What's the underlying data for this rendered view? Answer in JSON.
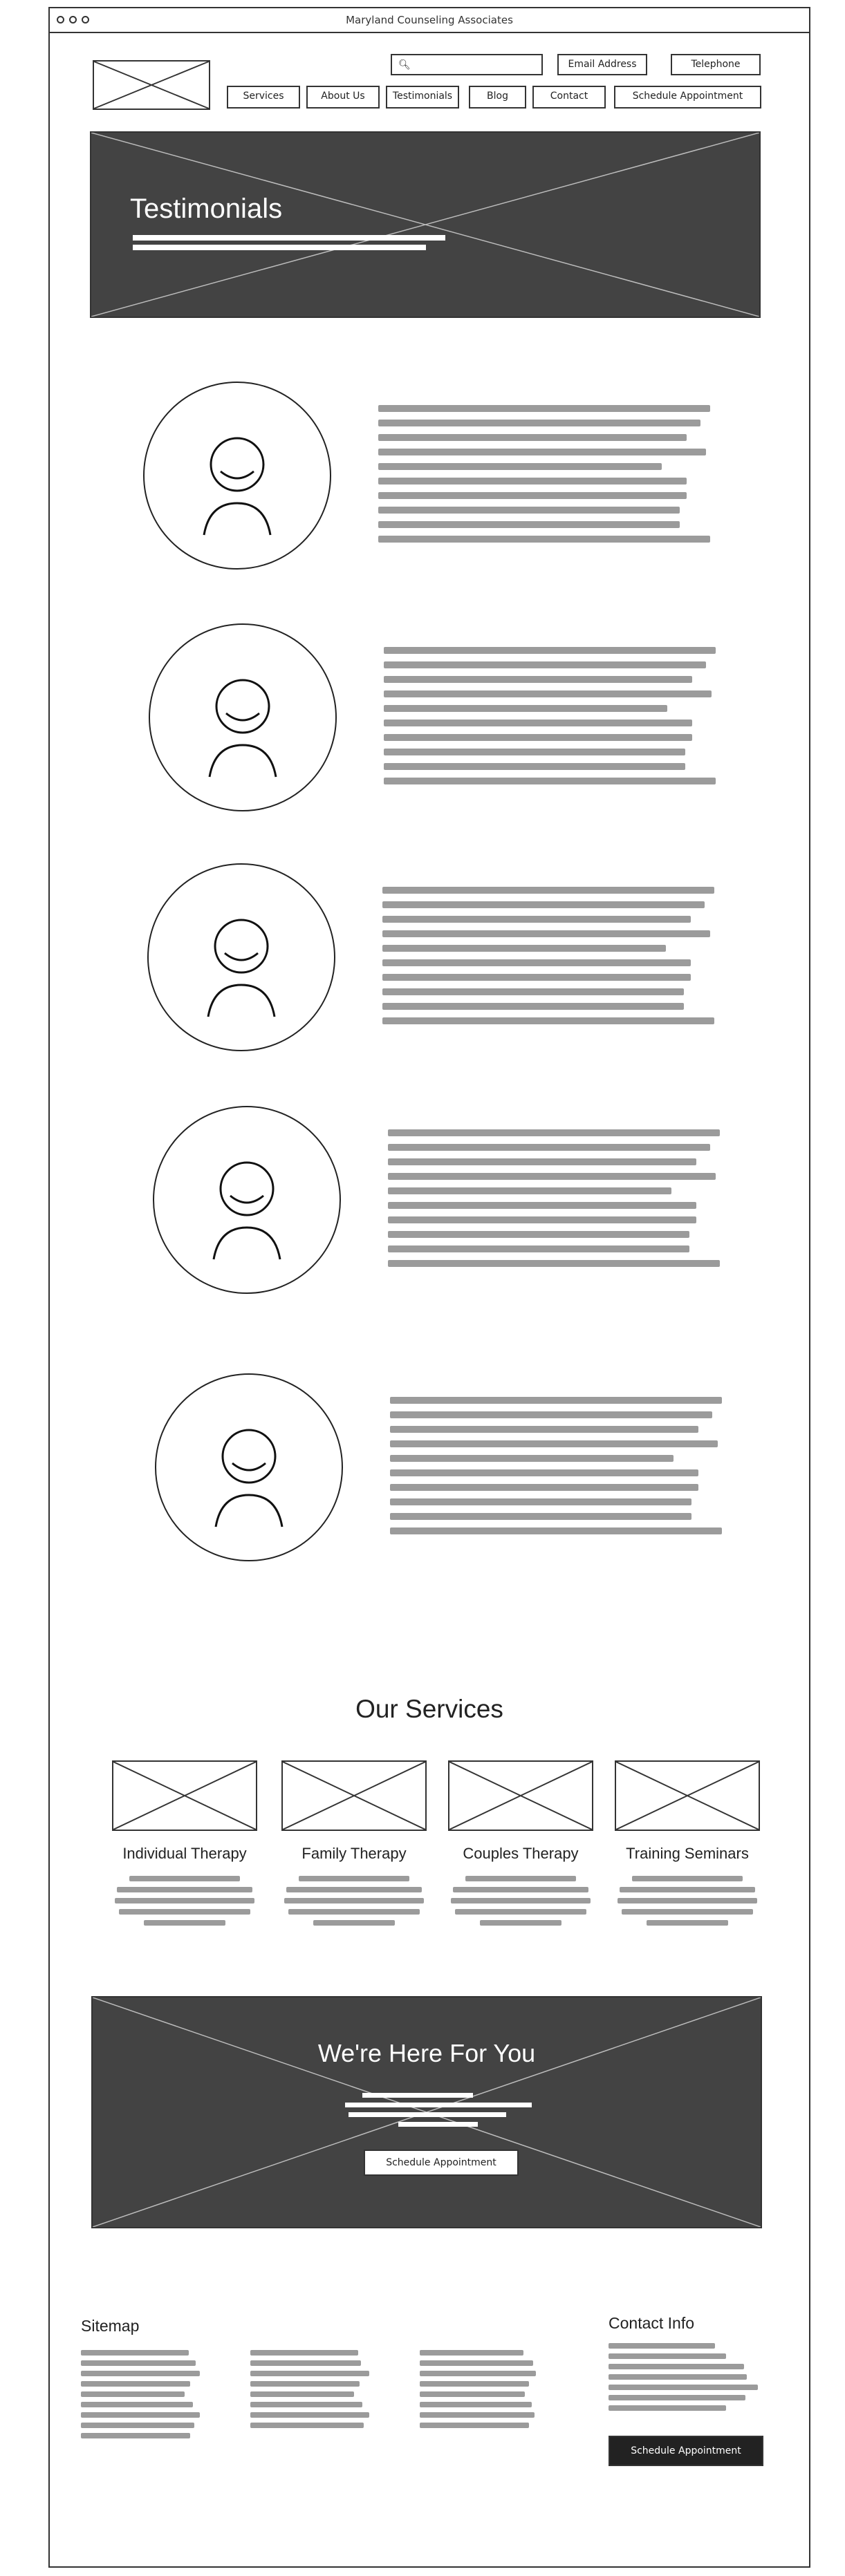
{
  "window": {
    "title": "Maryland Counseling Associates"
  },
  "header": {
    "search": {
      "placeholder": ""
    },
    "email_label": "Email Address",
    "phone_label": "Telephone",
    "nav": [
      {
        "label": "Services"
      },
      {
        "label": "About Us"
      },
      {
        "label": "Testimonials"
      },
      {
        "label": "Blog"
      },
      {
        "label": "Contact"
      },
      {
        "label": "Schedule Appointment"
      }
    ]
  },
  "hero": {
    "title": "Testimonials"
  },
  "testimonials": {
    "count": 5
  },
  "services": {
    "heading": "Our Services",
    "items": [
      {
        "title": "Individual Therapy"
      },
      {
        "title": "Family Therapy"
      },
      {
        "title": "Couples Therapy"
      },
      {
        "title": "Training Seminars"
      }
    ]
  },
  "cta": {
    "title": "We're Here For You",
    "button_label": "Schedule Appointment"
  },
  "footer": {
    "sitemap_heading": "Sitemap",
    "contact_heading": "Contact Info",
    "button_label": "Schedule Appointment"
  },
  "colors": {
    "dark_block": "#434343",
    "placeholder_line": "#9b9b9b",
    "border": "#333333"
  }
}
